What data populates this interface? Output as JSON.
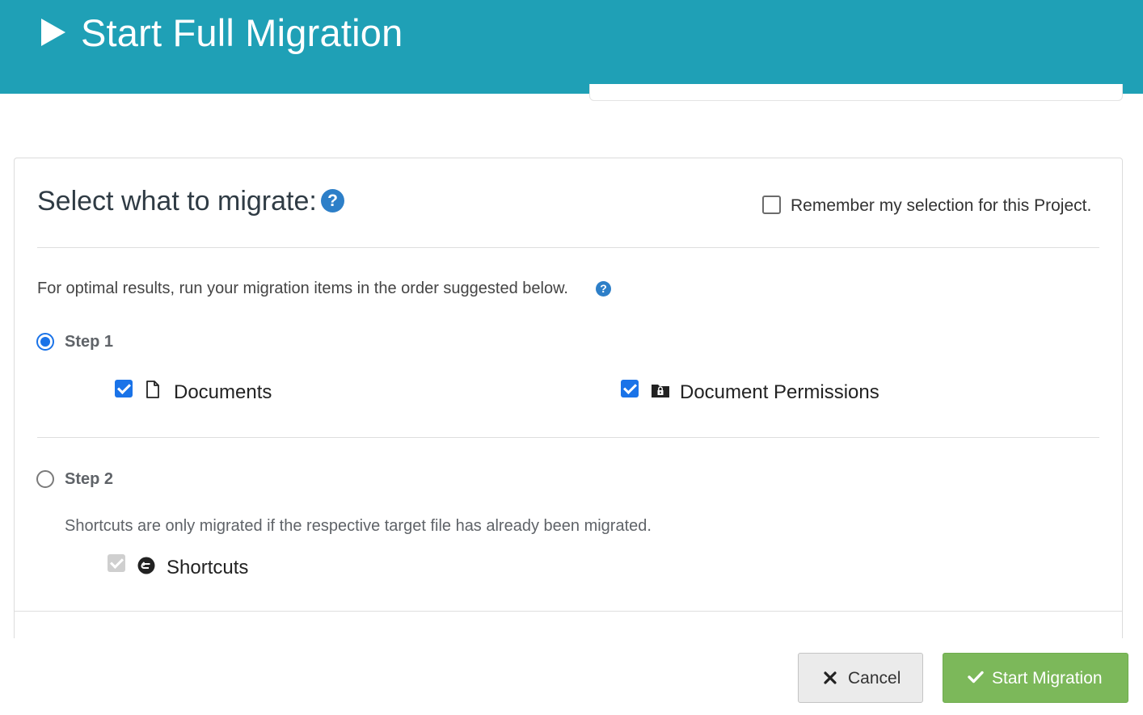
{
  "header": {
    "title": "Start Full Migration",
    "icon": "play-icon",
    "background": "#1fa0b6"
  },
  "panel": {
    "title": "Select what to migrate:",
    "help_glyph": "?",
    "remember": {
      "label": "Remember my selection for this Project.",
      "checked": false
    },
    "hint": "For optimal results, run your migration items in the order suggested below.",
    "hint_help_glyph": "?",
    "steps": [
      {
        "label": "Step 1",
        "selected": true,
        "items": [
          {
            "label": "Documents",
            "icon": "document-icon",
            "checked": true
          },
          {
            "label": "Document Permissions",
            "icon": "locked-folder-icon",
            "checked": true
          }
        ]
      },
      {
        "label": "Step 2",
        "selected": false,
        "note": "Shortcuts are only migrated if the respective target file has already been migrated.",
        "items": [
          {
            "label": "Shortcuts",
            "icon": "shortcut-icon",
            "checked": true,
            "disabled": true
          }
        ]
      }
    ]
  },
  "footer": {
    "cancel_label": "Cancel",
    "cancel_icon": "close-icon",
    "start_label": "Start Migration",
    "start_icon": "check-icon",
    "start_color": "#7cb85a"
  }
}
